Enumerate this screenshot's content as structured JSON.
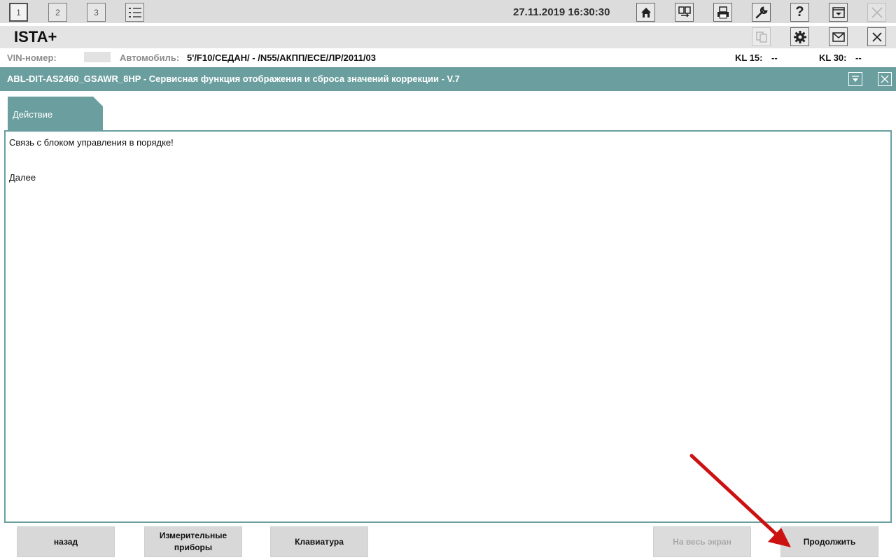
{
  "toolbar": {
    "tabs": [
      "1",
      "2",
      "3"
    ],
    "datetime": "27.11.2019 16:30:30",
    "icons": [
      "home-icon",
      "transfer-icon",
      "print-icon",
      "wrench-icon",
      "help-icon",
      "window-menu-icon",
      "close-icon"
    ]
  },
  "app": {
    "title": "ISTA+"
  },
  "vehicle": {
    "vin_label": "VIN-номер:",
    "car_label": "Автомобиль:",
    "car_value": "5'/F10/СЕДАН/ - /N55/АКПП/ECE/ЛР/2011/03",
    "kl15_label": "KL 15:",
    "kl15_value": "--",
    "kl30_label": "KL 30:",
    "kl30_value": "--"
  },
  "function": {
    "title": "ABL-DIT-AS2460_GSAWR_8HP - Сервисная функция отображения и сброса значений коррекции - V.7"
  },
  "tab": {
    "label": "Действие"
  },
  "content": {
    "message": "Связь с блоком управления в порядке!",
    "next": "Далее"
  },
  "buttons": {
    "back": "назад",
    "measuring_line1": "Измерительные",
    "measuring_line2": "приборы",
    "keyboard": "Клавиатура",
    "fullscreen": "На весь экран",
    "continue": "Продолжить"
  },
  "colors": {
    "accent": "#6b9e9e",
    "arrow": "#cc1111"
  }
}
